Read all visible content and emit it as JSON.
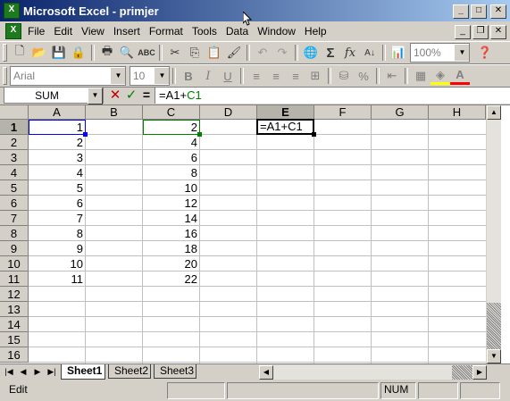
{
  "title": "Microsoft Excel - primjer",
  "app_icon": "excel-icon",
  "window_buttons": [
    "minimize-icon",
    "maximize-icon",
    "close-icon"
  ],
  "menu": [
    "File",
    "Edit",
    "View",
    "Insert",
    "Format",
    "Tools",
    "Data",
    "Window",
    "Help"
  ],
  "toolbar_standard": {
    "icons": [
      "new-icon",
      "open-icon",
      "save-icon",
      "permission-icon",
      "print-icon",
      "print-preview-icon",
      "spelling-icon",
      "cut-icon",
      "copy-icon",
      "paste-icon",
      "format-painter-icon",
      "undo-icon",
      "redo-icon",
      "hyperlink-icon",
      "autosum-icon",
      "insert-function-icon",
      "sort-ascending-icon",
      "chart-wizard-icon",
      "help-icon"
    ],
    "zoom": "100%"
  },
  "toolbar_formatting": {
    "font": "Arial",
    "size": "10",
    "bold": "B",
    "italic": "I",
    "underline": "U",
    "icons": [
      "align-left-icon",
      "align-center-icon",
      "align-right-icon",
      "merge-center-icon",
      "currency-icon",
      "percent-icon",
      "decrease-indent-icon",
      "borders-icon",
      "fill-color-icon",
      "font-color-icon"
    ]
  },
  "formula_bar": {
    "name_box": "SUM",
    "cancel": "✕",
    "enter": "✓",
    "equals": "=",
    "formula_prefix": "=A1+",
    "formula_suffix": "C1"
  },
  "columns": [
    "A",
    "B",
    "C",
    "D",
    "E",
    "F",
    "G",
    "H"
  ],
  "rows": [
    "1",
    "2",
    "3",
    "4",
    "5",
    "6",
    "7",
    "8",
    "9",
    "10",
    "11",
    "12",
    "13",
    "14",
    "15",
    "16"
  ],
  "colA": [
    "1",
    "2",
    "3",
    "4",
    "5",
    "6",
    "7",
    "8",
    "9",
    "10",
    "11"
  ],
  "colC": [
    "2",
    "4",
    "6",
    "8",
    "10",
    "12",
    "14",
    "16",
    "18",
    "20",
    "22"
  ],
  "active_cell": {
    "ref": "E1",
    "value": "=A1+C1"
  },
  "sheets": [
    "Sheet1",
    "Sheet2",
    "Sheet3"
  ],
  "status": {
    "mode": "Edit",
    "num": "NUM"
  },
  "colors": {
    "title_start": "#0a246a",
    "title_end": "#a6caf0",
    "ref_blue": "#0000ff",
    "ref_green": "#008000"
  }
}
